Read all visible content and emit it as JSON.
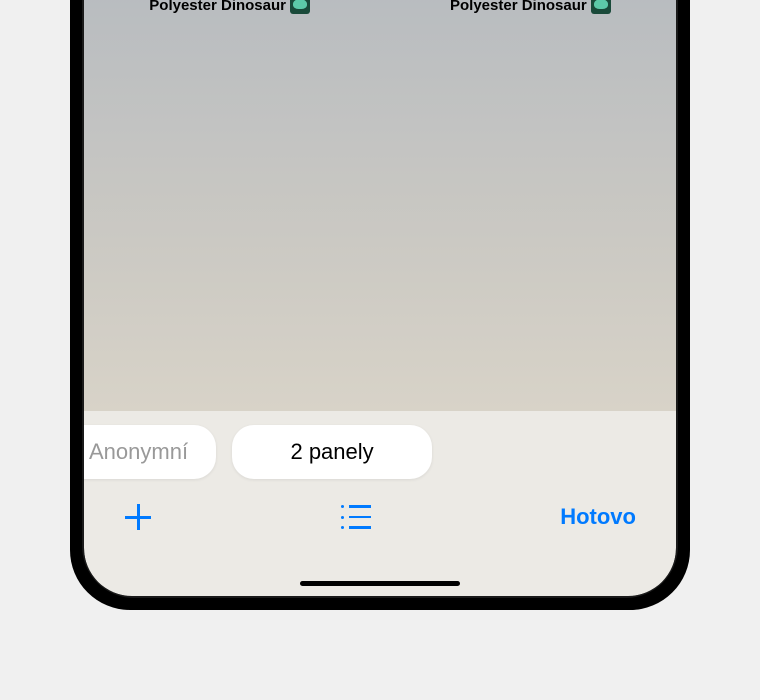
{
  "tabs": {
    "left": {
      "title": "Polyester Dinosaur"
    },
    "right": {
      "title": "Polyester Dinosaur"
    }
  },
  "pills": {
    "private": "Anonymní",
    "tab_count": "2 panely"
  },
  "toolbar": {
    "done": "Hotovo"
  }
}
